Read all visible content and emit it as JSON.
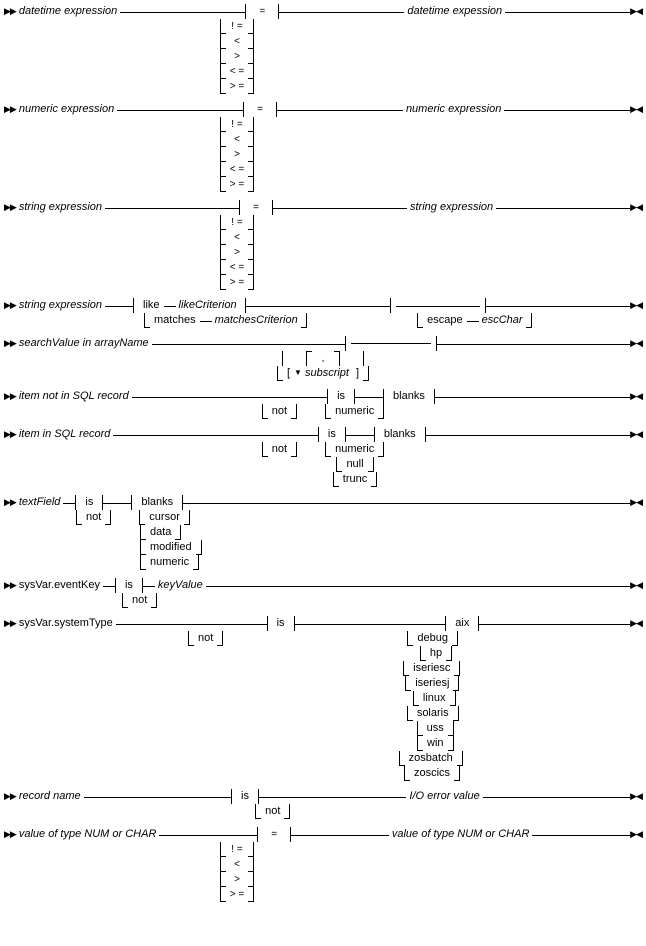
{
  "diagrams": [
    {
      "left": "datetime expression",
      "center_stack": [
        "=",
        "! =",
        "<",
        ">",
        "< =",
        "> ="
      ],
      "right": "datetime expession"
    },
    {
      "left": "numeric expression",
      "center_stack": [
        "=",
        "! =",
        "<",
        ">",
        "< =",
        "> ="
      ],
      "right": "numeric expression"
    },
    {
      "left": "string expression",
      "center_stack": [
        "=",
        "! =",
        "<",
        ">",
        "< =",
        "> ="
      ],
      "right": "string expression"
    },
    {
      "type": "like",
      "left": "string expression",
      "ops": [
        "like",
        "matches"
      ],
      "crits": [
        "likeCriterion",
        "matchesCriterion"
      ],
      "escape": "escape",
      "escChar": "escChar"
    },
    {
      "type": "search",
      "label": "searchValue in arrayName",
      "bracket_open": "[",
      "subscript": "subscript",
      "sep": ",",
      "bracket_close": "]"
    },
    {
      "type": "isnot",
      "left": "item not in SQL record",
      "isnot": [
        "is",
        "not"
      ],
      "opts": [
        "blanks",
        "numeric"
      ]
    },
    {
      "type": "isnot",
      "left": "item in SQL record",
      "isnot": [
        "is",
        "not"
      ],
      "opts": [
        "blanks",
        "numeric",
        "null",
        "trunc"
      ]
    },
    {
      "type": "textfield",
      "left": "textField",
      "isnot": [
        "is",
        "not"
      ],
      "opts": [
        "blanks",
        "cursor",
        "data",
        "modified",
        "numeric"
      ]
    },
    {
      "type": "eventkey",
      "left": "sysVar.eventKey",
      "isnot": [
        "is",
        "not"
      ],
      "key": "keyValue"
    },
    {
      "type": "systype",
      "left": "sysVar.systemType",
      "isnot": [
        "is",
        "not"
      ],
      "opts": [
        "aix",
        "debug",
        "hp",
        "iseriesc",
        "iseriesj",
        "linux",
        "solaris",
        "uss",
        "win",
        "zosbatch",
        "zoscics"
      ]
    },
    {
      "type": "isnot-single",
      "left": "record name",
      "isnot": [
        "is",
        "not"
      ],
      "right": "I/O error value"
    },
    {
      "left": "value of type NUM or CHAR",
      "center_stack": [
        "=",
        "! =",
        "<",
        ">",
        "> ="
      ],
      "right": "value of type NUM or CHAR"
    }
  ]
}
